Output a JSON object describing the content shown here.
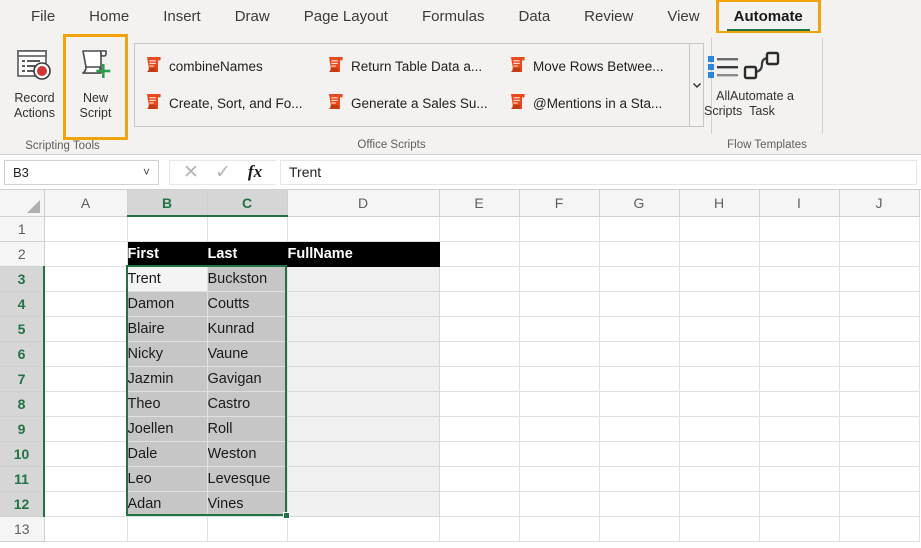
{
  "ribbon": {
    "tabs": [
      {
        "label": "File",
        "active": false,
        "boxed": false
      },
      {
        "label": "Home",
        "active": false,
        "boxed": false
      },
      {
        "label": "Insert",
        "active": false,
        "boxed": false
      },
      {
        "label": "Draw",
        "active": false,
        "boxed": false
      },
      {
        "label": "Page Layout",
        "active": false,
        "boxed": false
      },
      {
        "label": "Formulas",
        "active": false,
        "boxed": false
      },
      {
        "label": "Data",
        "active": false,
        "boxed": false
      },
      {
        "label": "Review",
        "active": false,
        "boxed": false
      },
      {
        "label": "View",
        "active": false,
        "boxed": false
      },
      {
        "label": "Automate",
        "active": true,
        "boxed": true
      }
    ],
    "groups": {
      "scripting_tools": {
        "label": "Scripting Tools",
        "record_actions": "Record\nActions",
        "record_actions_line1": "Record",
        "record_actions_line2": "Actions",
        "new_script_line1": "New",
        "new_script_line2": "Script"
      },
      "office_scripts": {
        "label": "Office Scripts",
        "items": [
          {
            "label": "combineNames"
          },
          {
            "label": "Return Table Data a..."
          },
          {
            "label": "Move Rows Betwee..."
          },
          {
            "label": "Create, Sort, and Fo..."
          },
          {
            "label": "Generate a Sales Su..."
          },
          {
            "label": "@Mentions in a Sta..."
          }
        ],
        "all_scripts_line1": "All",
        "all_scripts_line2": "Scripts"
      },
      "flow_templates": {
        "label": "Flow Templates",
        "automate_task_line1": "Automate a",
        "automate_task_line2": "Task"
      }
    },
    "highlight_color": "#f0a30a",
    "accent_color": "#217346",
    "script_icon_color": "#e8491d"
  },
  "formula_bar": {
    "name_box_value": "B3",
    "name_box_chevron": "˅",
    "cancel_glyph": "✕",
    "enter_glyph": "✓",
    "fx_glyph": "fx",
    "formula_value": "Trent"
  },
  "sheet": {
    "column_headers": [
      "A",
      "B",
      "C",
      "D",
      "E",
      "F",
      "G",
      "H",
      "I",
      "J"
    ],
    "selected_columns": [
      "B",
      "C"
    ],
    "row_headers": [
      "1",
      "2",
      "3",
      "4",
      "5",
      "6",
      "7",
      "8",
      "9",
      "10",
      "11",
      "12",
      "13"
    ],
    "selected_rows": [
      "3",
      "4",
      "5",
      "6",
      "7",
      "8",
      "9",
      "10",
      "11",
      "12"
    ],
    "active_cell": "B3",
    "selection_range": "B3:C12",
    "table_header": {
      "first": "First",
      "last": "Last",
      "fullname": "FullName"
    },
    "rows": [
      {
        "first": "Trent",
        "last": "Buckston",
        "fullname": ""
      },
      {
        "first": "Damon",
        "last": "Coutts",
        "fullname": ""
      },
      {
        "first": "Blaire",
        "last": "Kunrad",
        "fullname": ""
      },
      {
        "first": "Nicky",
        "last": "Vaune",
        "fullname": ""
      },
      {
        "first": "Jazmin",
        "last": "Gavigan",
        "fullname": ""
      },
      {
        "first": "Theo",
        "last": "Castro",
        "fullname": ""
      },
      {
        "first": "Joellen",
        "last": "Roll",
        "fullname": ""
      },
      {
        "first": "Dale",
        "last": "Weston",
        "fullname": ""
      },
      {
        "first": "Leo",
        "last": "Levesque",
        "fullname": ""
      },
      {
        "first": "Adan",
        "last": "Vines",
        "fullname": ""
      }
    ]
  }
}
